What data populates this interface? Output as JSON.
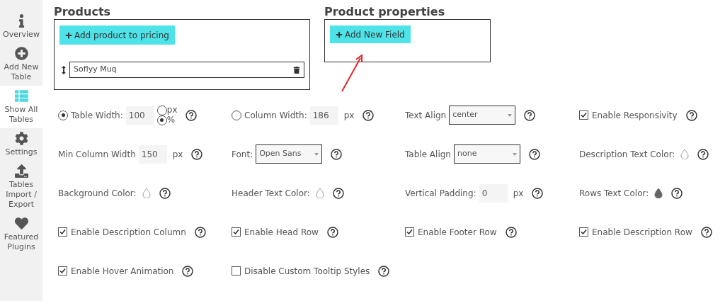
{
  "sidebar": {
    "items": [
      {
        "kind": "info",
        "label": "Overview",
        "selected": false
      },
      {
        "kind": "add",
        "label": "Add New Table",
        "selected": false
      },
      {
        "kind": "list",
        "label": "Show All Tables",
        "selected": true
      },
      {
        "kind": "settings",
        "label": "Settings",
        "selected": false
      },
      {
        "kind": "upload",
        "label": "Tables Import / Export",
        "selected": false
      },
      {
        "kind": "heart",
        "label": "Featured Plugins",
        "selected": false
      }
    ]
  },
  "products": {
    "title": "Products",
    "button": "Add product to pricing",
    "items": [
      {
        "name": "Soflyy Muq"
      }
    ]
  },
  "product_properties": {
    "title": "Product properties",
    "button": "Add New Field"
  },
  "settings": [
    {
      "kind": "width",
      "label": "Table Width:",
      "selected": true,
      "value": "100",
      "units": [
        {
          "label": "px",
          "selected": false
        },
        {
          "label": "%",
          "selected": true
        }
      ]
    },
    {
      "kind": "width",
      "label": "Column Width:",
      "selected": false,
      "value": "186",
      "unit": "px"
    },
    {
      "kind": "select",
      "label": "Text Align",
      "value": "center"
    },
    {
      "kind": "checkbox",
      "label": "Enable Responsivity",
      "checked": true
    },
    {
      "kind": "number",
      "label": "Min Column Width",
      "value": "150",
      "unit": "px"
    },
    {
      "kind": "select",
      "label": "Font:",
      "value": "Open Sans"
    },
    {
      "kind": "select",
      "label": "Table Align",
      "value": "none"
    },
    {
      "kind": "color",
      "label": "Description Text Color:",
      "filled": false
    },
    {
      "kind": "color",
      "label": "Background Color:",
      "filled": false
    },
    {
      "kind": "color",
      "label": "Header Text Color:",
      "filled": false
    },
    {
      "kind": "number",
      "label": "Vertical Padding:",
      "value": "0",
      "unit": "px"
    },
    {
      "kind": "color",
      "label": "Rows Text Color:",
      "filled": true
    },
    {
      "kind": "checkbox",
      "label": "Enable Description Column",
      "checked": true
    },
    {
      "kind": "checkbox",
      "label": "Enable Head Row",
      "checked": true
    },
    {
      "kind": "checkbox",
      "label": "Enable Footer Row",
      "checked": true
    },
    {
      "kind": "checkbox",
      "label": "Enable Description Row",
      "checked": true
    },
    {
      "kind": "checkbox",
      "label": "Enable Hover Animation",
      "checked": true
    },
    {
      "kind": "checkbox",
      "label": "Disable Custom Tooltip Styles",
      "checked": false
    }
  ]
}
